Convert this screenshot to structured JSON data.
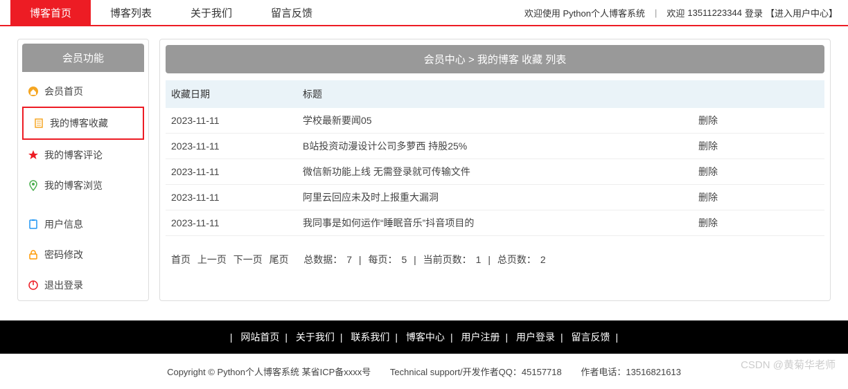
{
  "nav": {
    "tabs": [
      {
        "label": "博客首页",
        "active": true
      },
      {
        "label": "博客列表",
        "active": false
      },
      {
        "label": "关于我们",
        "active": false
      },
      {
        "label": "留言反馈",
        "active": false
      }
    ]
  },
  "header": {
    "welcome_system": "欢迎使用 Python个人博客系统",
    "welcome_user_prefix": "欢迎",
    "user_phone": "13511223344",
    "login_suffix": "登录",
    "user_center": "【进入用户中心】"
  },
  "sidebar": {
    "title": "会员功能",
    "items": [
      {
        "label": "会员首页",
        "icon": "home-icon",
        "color": "#f5a623"
      },
      {
        "label": "我的博客收藏",
        "icon": "document-icon",
        "color": "#f5a623",
        "active": true
      },
      {
        "label": "我的博客评论",
        "icon": "star-icon",
        "color": "#ed1c24"
      },
      {
        "label": "我的博客浏览",
        "icon": "location-icon",
        "color": "#4caf50"
      },
      {
        "label": "用户信息",
        "icon": "clipboard-icon",
        "color": "#2196f3"
      },
      {
        "label": "密码修改",
        "icon": "lock-icon",
        "color": "#ff9800"
      },
      {
        "label": "退出登录",
        "icon": "power-icon",
        "color": "#ed1c24"
      }
    ]
  },
  "breadcrumb": {
    "text": "会员中心 > 我的博客 收藏 列表"
  },
  "table": {
    "headers": {
      "date": "收藏日期",
      "title": "标题",
      "action": ""
    },
    "action_label": "删除",
    "rows": [
      {
        "date": "2023-11-11",
        "title": "学校最新要闻05"
      },
      {
        "date": "2023-11-11",
        "title": "B站投资动漫设计公司多萝西 持股25%"
      },
      {
        "date": "2023-11-11",
        "title": "微信新功能上线 无需登录就可传输文件"
      },
      {
        "date": "2023-11-11",
        "title": "阿里云回应未及时上报重大漏洞"
      },
      {
        "date": "2023-11-11",
        "title": "我同事是如何运作“睡眠音乐”抖音项目的"
      }
    ]
  },
  "pagination": {
    "first": "首页",
    "prev": "上一页",
    "next": "下一页",
    "last": "尾页",
    "total_label": "总数据：",
    "total": "7",
    "per_page_label": "每页：",
    "per_page": "5",
    "current_label": "当前页数：",
    "current": "1",
    "pages_label": "总页数：",
    "pages": "2"
  },
  "footer": {
    "nav": [
      "网站首页",
      "关于我们",
      "联系我们",
      "博客中心",
      "用户注册",
      "用户登录",
      "留言反馈"
    ],
    "copyright": "Copyright © Python个人博客系统 某省ICP备xxxx号",
    "tech": "Technical support/开发作者QQ：45157718",
    "phone": "作者电话：13516821613"
  },
  "watermark": "CSDN @黄菊华老师"
}
